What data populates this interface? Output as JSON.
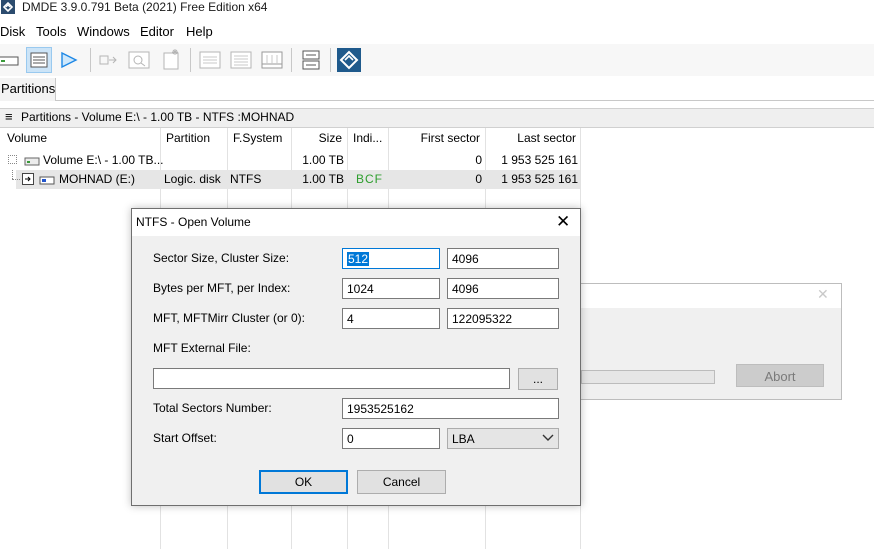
{
  "app": {
    "title": "DMDE 3.9.0.791 Beta (2021) Free Edition x64"
  },
  "menu": [
    "Disk",
    "Tools",
    "Windows",
    "Editor",
    "Help"
  ],
  "toolbar": {
    "icons": [
      "drive-icon",
      "partitions-list-icon",
      "play-icon",
      "open-volume-icon",
      "find-icon",
      "new-file-icon",
      "sector-view-icon",
      "list-view-icon",
      "grid-view-icon",
      "log-icon",
      "dmde-logo-icon"
    ]
  },
  "tabs": [
    {
      "label": "Partitions",
      "active": true
    }
  ],
  "panel": {
    "title": "Partitions - Volume E:\\ - 1.00 TB - NTFS :MOHNAD"
  },
  "table": {
    "columns": [
      "Volume",
      "Partition",
      "F.System",
      "Size",
      "Indi...",
      "First sector",
      "Last sector"
    ],
    "rows": [
      {
        "volume": "Volume E:\\ - 1.00 TB...",
        "partition": "",
        "fs": "",
        "size": "1.00 TB",
        "indicators": "",
        "first": "0",
        "last": "1 953 525 161"
      },
      {
        "volume": "MOHNAD (E:)",
        "partition": "Logic. disk",
        "fs": "NTFS",
        "size": "1.00 TB",
        "indicators": "BCF",
        "first": "0",
        "last": "1 953 525 161"
      }
    ],
    "indicator_color": "#2e9e2e"
  },
  "back_dialog": {
    "abort_label": "Abort"
  },
  "dialog": {
    "title": "NTFS - Open Volume",
    "sector_label": "Sector Size, Cluster Size:",
    "sector_size": "512",
    "cluster_size": "4096",
    "mft_bytes_label": "Bytes per MFT, per Index:",
    "bytes_per_mft": "1024",
    "bytes_per_index": "4096",
    "mft_cluster_label": "MFT, MFTMirr Cluster (or 0):",
    "mft_cluster": "4",
    "mftmirr_cluster": "122095322",
    "ext_file_label": "MFT External File:",
    "ext_file_value": "",
    "browse_label": "...",
    "total_sectors_label": "Total Sectors Number:",
    "total_sectors": "1953525162",
    "start_offset_label": "Start Offset:",
    "start_offset": "0",
    "offset_unit": "LBA",
    "ok_label": "OK",
    "cancel_label": "Cancel"
  },
  "colors": {
    "accent": "#0078d7",
    "selection": "#cce4f7",
    "logo": "#1f5a8c"
  }
}
